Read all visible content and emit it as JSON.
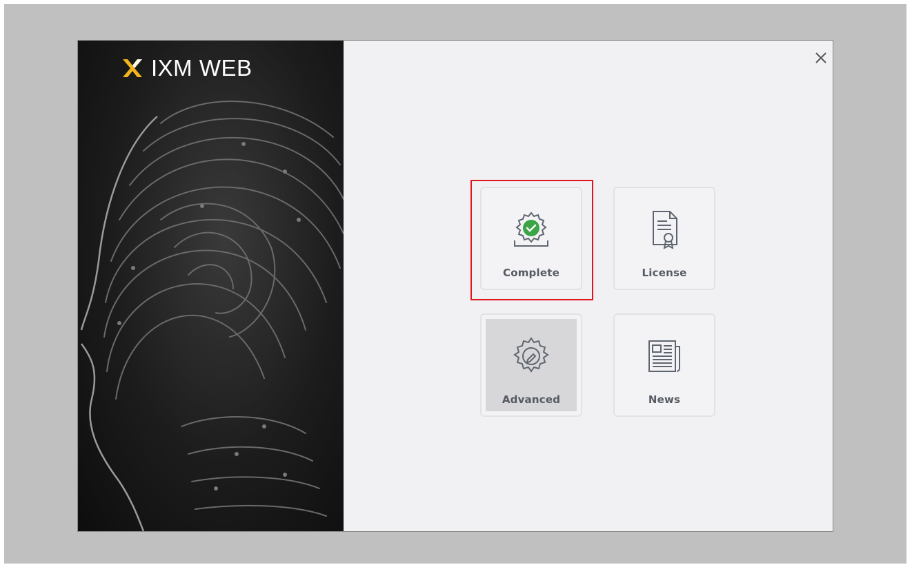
{
  "app": {
    "title": "IXM WEB"
  },
  "tiles": [
    {
      "label": "Complete",
      "icon": "gear-check-icon"
    },
    {
      "label": "License",
      "icon": "certificate-icon"
    },
    {
      "label": "Advanced",
      "icon": "gear-edit-icon"
    },
    {
      "label": "News",
      "icon": "newspaper-icon"
    }
  ],
  "colors": {
    "accent_check": "#3aa447",
    "logo_yellow": "#f2b51c",
    "highlight_red": "#e0161d"
  }
}
